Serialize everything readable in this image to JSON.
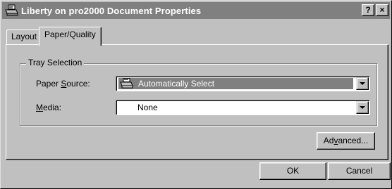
{
  "window": {
    "title": "Liberty on pro2000 Document Properties",
    "help_button": "?",
    "close_button": "×"
  },
  "tabs": [
    {
      "label": "Layout",
      "active": false
    },
    {
      "label": "Paper/Quality",
      "active": true
    }
  ],
  "tray_selection": {
    "group_label": "Tray Selection",
    "paper_source": {
      "label_pre": "Paper ",
      "label_mn": "S",
      "label_post": "ource:",
      "value": "Automatically Select",
      "icon": "printer-icon"
    },
    "media": {
      "label_mn": "M",
      "label_post": "edia:",
      "value": "None"
    }
  },
  "buttons": {
    "advanced_pre": "Ad",
    "advanced_mn": "v",
    "advanced_post": "anced...",
    "ok": "OK",
    "cancel": "Cancel"
  },
  "colors": {
    "face": "#c0c0c0",
    "titlebar_inactive": "#808080",
    "selection": "#808080"
  }
}
